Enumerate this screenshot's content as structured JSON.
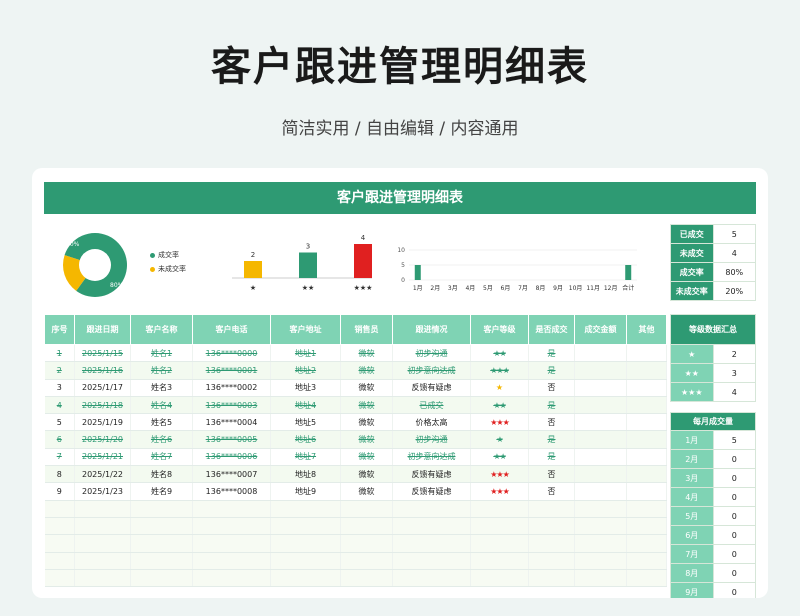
{
  "page": {
    "title": "客户跟进管理明细表",
    "subtitle": "简洁实用 / 自由编辑 / 内容通用"
  },
  "sheet": {
    "title": "客户跟进管理明细表",
    "colors": {
      "primary": "#2e9a73",
      "header": "#7fd3b4",
      "warn": "#e02020",
      "gold": "#f5b700"
    }
  },
  "donut": {
    "legend": [
      "成交率",
      "未成交率"
    ],
    "values": [
      80,
      20
    ],
    "labels": [
      "80%",
      "20%"
    ]
  },
  "chart_data": [
    {
      "type": "bar",
      "categories": [
        "★",
        "★★",
        "★★★"
      ],
      "values": [
        2,
        3,
        4
      ],
      "colors": [
        "#f5b700",
        "#2e9a73",
        "#e02020"
      ]
    },
    {
      "type": "bar",
      "categories": [
        "1月",
        "2月",
        "3月",
        "4月",
        "5月",
        "6月",
        "7月",
        "8月",
        "9月",
        "10月",
        "11月",
        "12月",
        "合计"
      ],
      "values": [
        5,
        0,
        0,
        0,
        0,
        0,
        0,
        0,
        0,
        0,
        0,
        0,
        5
      ],
      "y_ticks": [
        "10",
        "5",
        "0"
      ],
      "ylim": [
        0,
        10
      ]
    }
  ],
  "table": {
    "headers": [
      "序号",
      "跟进日期",
      "客户名称",
      "客户电话",
      "客户地址",
      "销售员",
      "跟进情况",
      "客户等级",
      "是否成交",
      "成交金额",
      "其他"
    ],
    "rows": [
      {
        "no": "1",
        "date": "2025/1/15",
        "name": "姓名1",
        "phone": "136****0000",
        "addr": "地址1",
        "sales": "微软",
        "status": "初步沟通",
        "level": "★★",
        "deal": "是",
        "done": true
      },
      {
        "no": "2",
        "date": "2025/1/16",
        "name": "姓名2",
        "phone": "136****0001",
        "addr": "地址2",
        "sales": "微软",
        "status": "初步意向达成",
        "level": "★★★",
        "deal": "是",
        "done": true
      },
      {
        "no": "3",
        "date": "2025/1/17",
        "name": "姓名3",
        "phone": "136****0002",
        "addr": "地址3",
        "sales": "微软",
        "status": "反馈有疑虑",
        "level": "★",
        "deal": "否",
        "done": false
      },
      {
        "no": "4",
        "date": "2025/1/18",
        "name": "姓名4",
        "phone": "136****0003",
        "addr": "地址4",
        "sales": "微软",
        "status": "已成交",
        "level": "★★",
        "deal": "是",
        "done": true
      },
      {
        "no": "5",
        "date": "2025/1/19",
        "name": "姓名5",
        "phone": "136****0004",
        "addr": "地址5",
        "sales": "微软",
        "status": "价格太高",
        "level": "★★★",
        "deal": "否",
        "done": false
      },
      {
        "no": "6",
        "date": "2025/1/20",
        "name": "姓名6",
        "phone": "136****0005",
        "addr": "地址6",
        "sales": "微软",
        "status": "初步沟通",
        "level": "★",
        "deal": "是",
        "done": true
      },
      {
        "no": "7",
        "date": "2025/1/21",
        "name": "姓名7",
        "phone": "136****0006",
        "addr": "地址7",
        "sales": "微软",
        "status": "初步意向达成",
        "level": "★★",
        "deal": "是",
        "done": true
      },
      {
        "no": "8",
        "date": "2025/1/22",
        "name": "姓名8",
        "phone": "136****0007",
        "addr": "地址8",
        "sales": "微软",
        "status": "反馈有疑虑",
        "level": "★★★",
        "deal": "否",
        "done": false
      },
      {
        "no": "9",
        "date": "2025/1/23",
        "name": "姓名9",
        "phone": "136****0008",
        "addr": "地址9",
        "sales": "微软",
        "status": "反馈有疑虑",
        "level": "★★★",
        "deal": "否",
        "done": false
      }
    ],
    "empty_rows": 5
  },
  "summary": [
    {
      "label": "已成交",
      "value": "5"
    },
    {
      "label": "未成交",
      "value": "4"
    },
    {
      "label": "成交率",
      "value": "80%"
    },
    {
      "label": "未成交率",
      "value": "20%"
    }
  ],
  "level_summary": {
    "title": "等级数据汇总",
    "rows": [
      {
        "label": "★",
        "value": "2"
      },
      {
        "label": "★★",
        "value": "3"
      },
      {
        "label": "★★★",
        "value": "4"
      }
    ]
  },
  "monthly": {
    "title": "每月成交量",
    "rows": [
      {
        "label": "1月",
        "value": "5"
      },
      {
        "label": "2月",
        "value": "0"
      },
      {
        "label": "3月",
        "value": "0"
      },
      {
        "label": "4月",
        "value": "0"
      },
      {
        "label": "5月",
        "value": "0"
      },
      {
        "label": "6月",
        "value": "0"
      },
      {
        "label": "7月",
        "value": "0"
      },
      {
        "label": "8月",
        "value": "0"
      },
      {
        "label": "9月",
        "value": "0"
      }
    ]
  }
}
